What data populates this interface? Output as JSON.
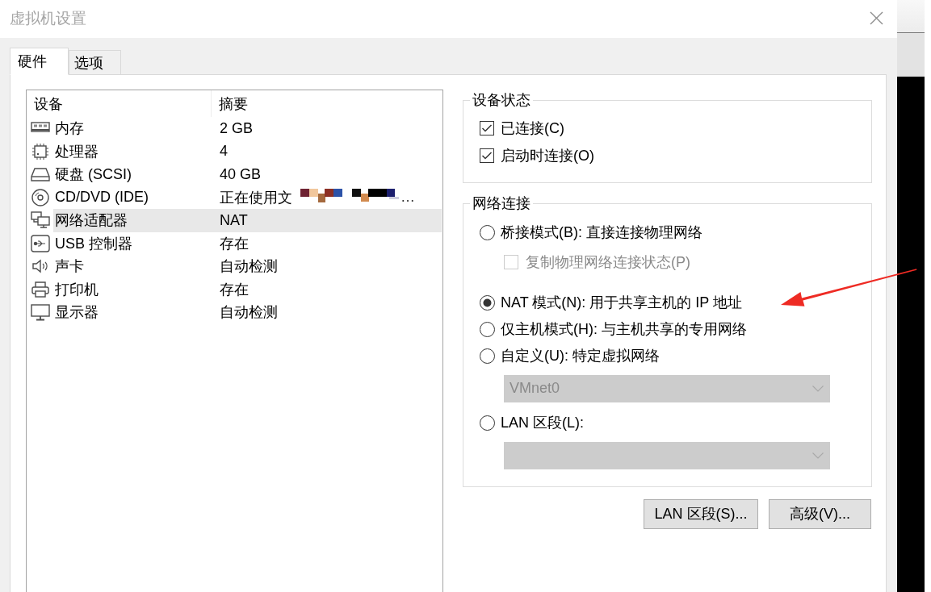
{
  "window": {
    "title": "虚拟机设置"
  },
  "tabs": [
    {
      "label": "硬件",
      "selected": true
    },
    {
      "label": "选项",
      "selected": false
    }
  ],
  "device_table": {
    "columns": [
      "设备",
      "摘要"
    ],
    "rows": [
      {
        "kind": "memory",
        "device": "内存",
        "summary": "2 GB",
        "redacted": false,
        "selected": false
      },
      {
        "kind": "processor",
        "device": "处理器",
        "summary": "4",
        "redacted": false,
        "selected": false
      },
      {
        "kind": "disk",
        "device": "硬盘 (SCSI)",
        "summary": "40 GB",
        "redacted": false,
        "selected": false
      },
      {
        "kind": "cd",
        "device": "CD/DVD (IDE)",
        "summary": "正在使用文",
        "redacted": true,
        "summary_suffix": "…",
        "selected": false
      },
      {
        "kind": "network",
        "device": "网络适配器",
        "summary": "NAT",
        "redacted": false,
        "selected": true
      },
      {
        "kind": "usb",
        "device": "USB 控制器",
        "summary": "存在",
        "redacted": false,
        "selected": false
      },
      {
        "kind": "sound",
        "device": "声卡",
        "summary": "自动检测",
        "redacted": false,
        "selected": false
      },
      {
        "kind": "printer",
        "device": "打印机",
        "summary": "存在",
        "redacted": false,
        "selected": false
      },
      {
        "kind": "display",
        "device": "显示器",
        "summary": "自动检测",
        "redacted": false,
        "selected": false
      }
    ]
  },
  "device_status": {
    "legend": "设备状态",
    "options": [
      {
        "label": "已连接(C)",
        "checked": true
      },
      {
        "label": "启动时连接(O)",
        "checked": true
      }
    ]
  },
  "network_connection": {
    "legend": "网络连接",
    "options": [
      {
        "kind": "radio",
        "label": "桥接模式(B): 直接连接物理网络",
        "selected": false,
        "disabled": false
      },
      {
        "kind": "checkbox",
        "label": "复制物理网络连接状态(P)",
        "checked": false,
        "disabled": true
      },
      {
        "kind": "radio",
        "label": "NAT 模式(N): 用于共享主机的 IP 地址",
        "selected": true,
        "disabled": false
      },
      {
        "kind": "radio",
        "label": "仅主机模式(H): 与主机共享的专用网络",
        "selected": false,
        "disabled": false
      },
      {
        "kind": "radio",
        "label": "自定义(U): 特定虚拟网络",
        "selected": false,
        "disabled": false
      },
      {
        "kind": "dropdown",
        "value": "VMnet0",
        "disabled": true
      },
      {
        "kind": "radio",
        "label": "LAN 区段(L):",
        "selected": false,
        "disabled": false
      },
      {
        "kind": "dropdown",
        "disabled": true
      }
    ]
  },
  "buttons": [
    {
      "label": "LAN 区段(S)..."
    },
    {
      "label": "高级(V)..."
    }
  ]
}
